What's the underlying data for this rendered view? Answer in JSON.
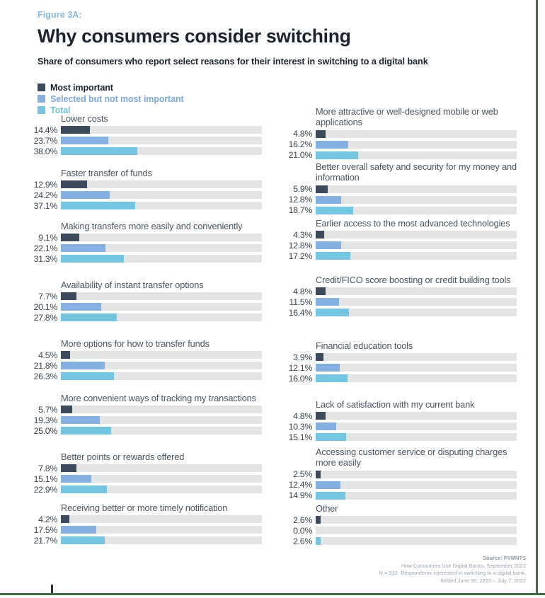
{
  "figure_label": "Figure 3A:",
  "title": "Why consumers consider switching",
  "subtitle": "Share of consumers who report select reasons for their interest in switching to a digital bank",
  "colors": {
    "most_important": "#3d4a5c",
    "selected_not_most": "#85b0e0",
    "total": "#74c6e0",
    "track": "#e4e4e4",
    "label_blue": "#8ab9e0",
    "rule_green": "#3f6b47",
    "category_text": "#4a5560"
  },
  "legend": [
    {
      "label": "Most important",
      "color": "#3d4a5c",
      "text_color": "#1b232e"
    },
    {
      "label": "Selected but not most important",
      "color": "#85b0e0",
      "text_color": "#7fa9d8"
    },
    {
      "label": "Total",
      "color": "#74c6e0",
      "text_color": "#6fc0dc"
    }
  ],
  "footer": {
    "source": "Source: PYMNTS",
    "line2": "How Consumers Use Digital Banks, September 2022",
    "line3": "N = 532: Respondents interested in switching to a digital bank,",
    "line4": "fielded June 30, 2022 – July 7, 2022"
  },
  "chart_data": {
    "type": "bar",
    "title": "Why consumers consider switching",
    "subtitle": "Share of consumers who report select reasons for their interest in switching to a digital bank",
    "xlabel": "",
    "ylabel": "",
    "xlim": [
      0,
      100
    ],
    "grid": false,
    "legend_position": "top-left",
    "series_names": [
      "Most important",
      "Selected but not most important",
      "Total"
    ],
    "value_format": "percent_one_decimal",
    "left_column": [
      {
        "category": "Lower costs",
        "values": [
          14.4,
          23.7,
          38.0
        ],
        "labels": [
          "14.4%",
          "23.7%",
          "38.0%"
        ]
      },
      {
        "category": "Faster transfer of funds",
        "values": [
          12.9,
          24.2,
          37.1
        ],
        "labels": [
          "12.9%",
          "24.2%",
          "37.1%"
        ]
      },
      {
        "category": "Making transfers more easily and conveniently",
        "values": [
          9.1,
          22.1,
          31.3
        ],
        "labels": [
          "9.1%",
          "22.1%",
          "31.3%"
        ]
      },
      {
        "category": "Availability of instant transfer options",
        "values": [
          7.7,
          20.1,
          27.8
        ],
        "labels": [
          "7.7%",
          "20.1%",
          "27.8%"
        ]
      },
      {
        "category": "More options for how to transfer funds",
        "values": [
          4.5,
          21.8,
          26.3
        ],
        "labels": [
          "4.5%",
          "21.8%",
          "26.3%"
        ]
      },
      {
        "category": "More convenient ways of tracking my transactions",
        "values": [
          5.7,
          19.3,
          25.0
        ],
        "labels": [
          "5.7%",
          "19.3%",
          "25.0%"
        ]
      },
      {
        "category": "Better points or rewards offered",
        "values": [
          7.8,
          15.1,
          22.9
        ],
        "labels": [
          "7.8%",
          "15.1%",
          "22.9%"
        ]
      },
      {
        "category": "Receiving better or more timely notification",
        "values": [
          4.2,
          17.5,
          21.7
        ],
        "labels": [
          "4.2%",
          "17.5%",
          "21.7%"
        ]
      }
    ],
    "right_column": [
      {
        "category": "More attractive or well-designed mobile or web applications",
        "values": [
          4.8,
          16.2,
          21.0
        ],
        "labels": [
          "4.8%",
          "16.2%",
          "21.0%"
        ]
      },
      {
        "category": "Better overall safety and security for my money and information",
        "values": [
          5.9,
          12.8,
          18.7
        ],
        "labels": [
          "5.9%",
          "12.8%",
          "18.7%"
        ]
      },
      {
        "category": "Earlier access to the most advanced technologies",
        "values": [
          4.3,
          12.8,
          17.2
        ],
        "labels": [
          "4.3%",
          "12.8%",
          "17.2%"
        ]
      },
      {
        "category": "Credit/FICO score boosting or credit building tools",
        "values": [
          4.8,
          11.5,
          16.4
        ],
        "labels": [
          "4.8%",
          "11.5%",
          "16.4%"
        ]
      },
      {
        "category": "Financial education tools",
        "values": [
          3.9,
          12.1,
          16.0
        ],
        "labels": [
          "3.9%",
          "12.1%",
          "16.0%"
        ]
      },
      {
        "category": "Lack of satisfaction with my current bank",
        "values": [
          4.8,
          10.3,
          15.1
        ],
        "labels": [
          "4.8%",
          "10.3%",
          "15.1%"
        ]
      },
      {
        "category": "Accessing customer service or disputing charges more easily",
        "values": [
          2.5,
          12.4,
          14.9
        ],
        "labels": [
          "2.5%",
          "12.4%",
          "14.9%"
        ]
      },
      {
        "category": "Other",
        "values": [
          2.6,
          0.0,
          2.6
        ],
        "labels": [
          "2.6%",
          "0.0%",
          "2.6%"
        ]
      }
    ]
  }
}
